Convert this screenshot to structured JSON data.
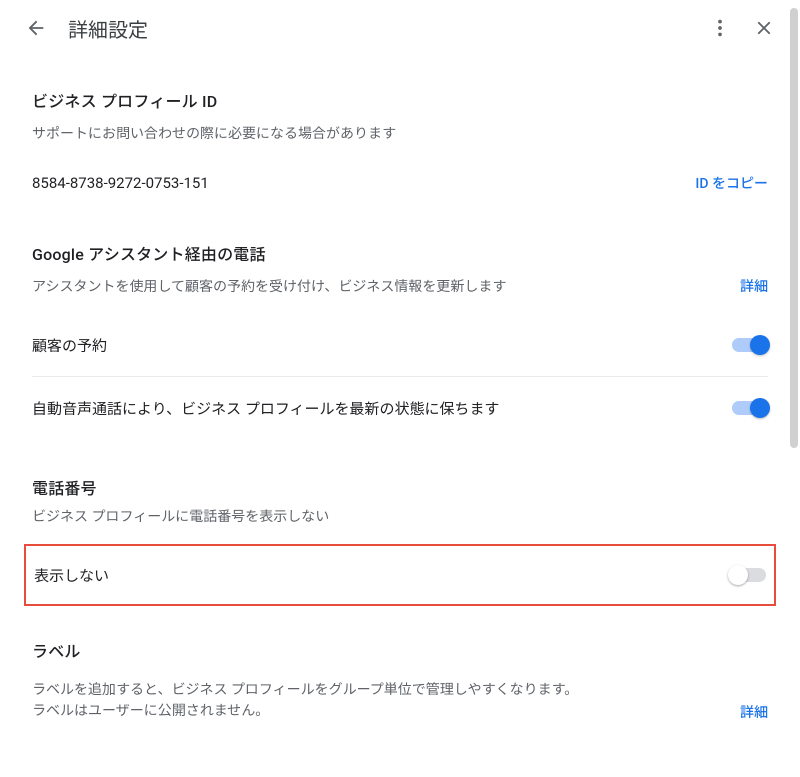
{
  "header": {
    "title": "詳細設定"
  },
  "profileId": {
    "title": "ビジネス プロフィール ID",
    "subtitle": "サポートにお問い合わせの際に必要になる場合があります",
    "value": "8584-8738-9272-0753-151",
    "copy": "ID をコピー"
  },
  "assistant": {
    "title": "Google アシスタント経由の電話",
    "subtitle": "アシスタントを使用して顧客の予約を受け付け、ビジネス情報を更新します",
    "detailsLink": "詳細",
    "row1": "顧客の予約",
    "row2": "自動音声通話により、ビジネス プロフィールを最新の状態に保ちます"
  },
  "phone": {
    "title": "電話番号",
    "subtitle": "ビジネス プロフィールに電話番号を表示しない",
    "toggleLabel": "表示しない"
  },
  "labels": {
    "title": "ラベル",
    "subtitle": "ラベルを追加すると、ビジネス プロフィールをグループ単位で管理しやすくなります。ラベルはユーザーに公開されません。",
    "detailsLink": "詳細"
  }
}
